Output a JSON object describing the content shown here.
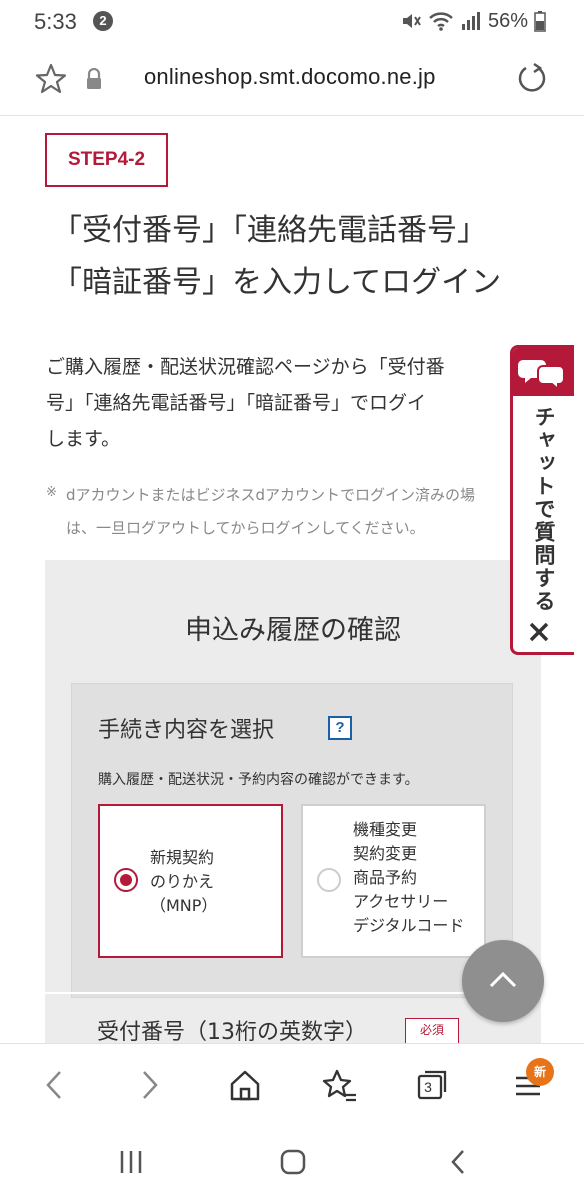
{
  "status_bar": {
    "time": "5:33",
    "notification_count": "2",
    "battery": "56%"
  },
  "browser": {
    "url": "onlineshop.smt.docomo.ne.jp",
    "open_tabs": "3",
    "menu_badge": "新"
  },
  "page": {
    "step_label": "STEP4-2",
    "headline_lines": [
      "「受付番号」「連絡先電話番号」",
      "「暗証番号」を入力してログイン"
    ],
    "description_lines": [
      "ご購入履歴・配送状況確認ページから「受付番",
      "号」「連絡先電話番号」「暗証番号」でログイ",
      "します。"
    ],
    "note_mark": "※",
    "note_lines": [
      "dアカウントまたはビジネスdアカウントでログイン済みの場",
      "は、一旦ログアウトしてからログインしてください。"
    ],
    "form": {
      "title": "申込み履歴の確認",
      "section_title": "手続き内容を選択",
      "help_label": "?",
      "section_subtitle": "購入履歴・配送状況・予約内容の確認ができます。",
      "options": [
        {
          "lines": [
            "新規契約",
            "のりかえ",
            "（MNP）"
          ],
          "selected": true
        },
        {
          "lines": [
            "機種変更",
            "契約変更",
            "商品予約",
            "アクセサリー",
            "デジタルコード"
          ],
          "selected": false
        }
      ],
      "next_field_label": "受付番号（13桁の英数字）",
      "required_label": "必須"
    }
  },
  "chat_widget": {
    "label": "チャットで質問する"
  },
  "colors": {
    "accent": "#b5193a",
    "help_blue": "#1a5fa8",
    "panel_bg": "#ececec",
    "badge_orange": "#e8741a"
  }
}
